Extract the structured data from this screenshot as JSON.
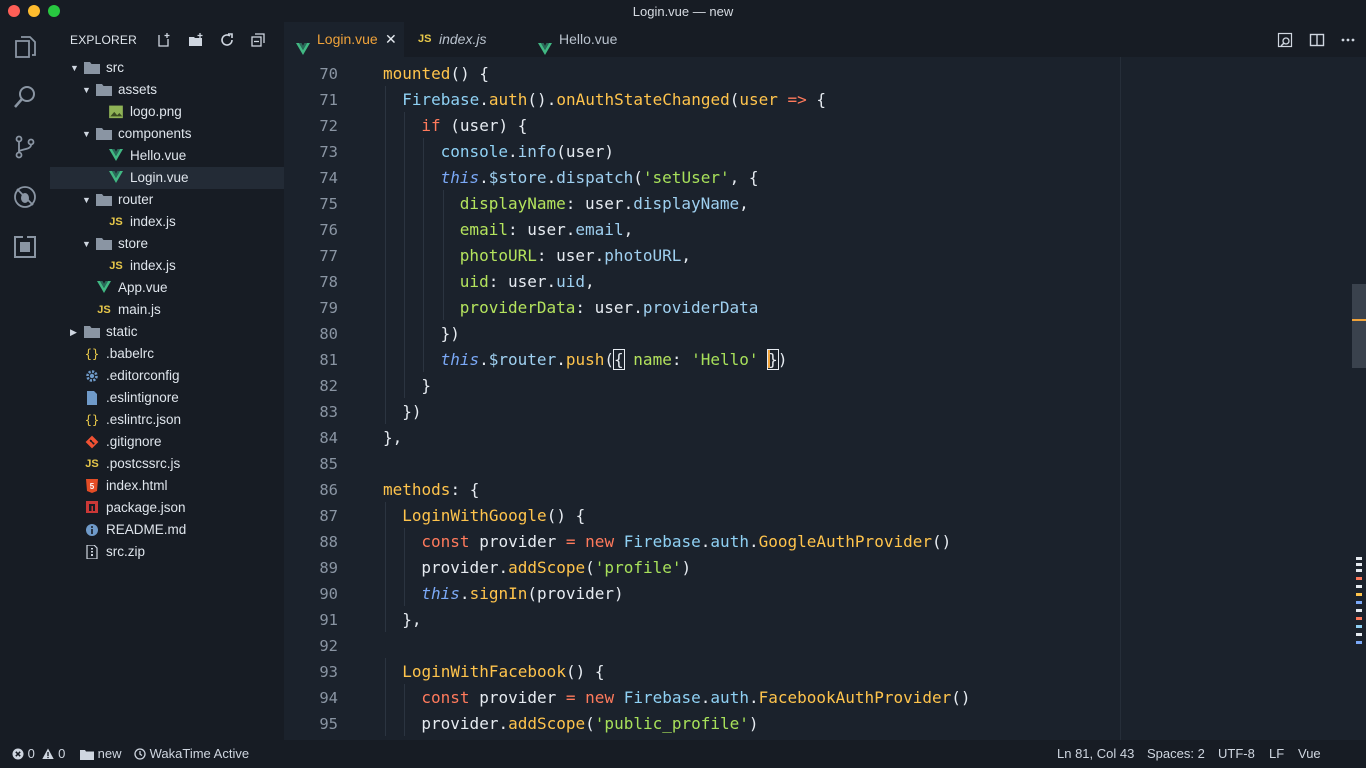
{
  "window": {
    "title": "Login.vue — new"
  },
  "activity_bar": {
    "items": [
      {
        "name": "explorer-icon"
      },
      {
        "name": "search-icon"
      },
      {
        "name": "source-control-icon"
      },
      {
        "name": "debug-icon"
      },
      {
        "name": "extensions-icon"
      }
    ]
  },
  "sidebar": {
    "title": "EXPLORER",
    "tree": [
      {
        "label": "src",
        "type": "folder",
        "depth": 0,
        "expanded": true
      },
      {
        "label": "assets",
        "type": "folder",
        "depth": 1,
        "expanded": true
      },
      {
        "label": "logo.png",
        "type": "image",
        "depth": 2
      },
      {
        "label": "components",
        "type": "folder",
        "depth": 1,
        "expanded": true
      },
      {
        "label": "Hello.vue",
        "type": "vue",
        "depth": 2
      },
      {
        "label": "Login.vue",
        "type": "vue",
        "depth": 2,
        "selected": true
      },
      {
        "label": "router",
        "type": "folder",
        "depth": 1,
        "expanded": true
      },
      {
        "label": "index.js",
        "type": "js",
        "depth": 2
      },
      {
        "label": "store",
        "type": "folder",
        "depth": 1,
        "expanded": true
      },
      {
        "label": "index.js",
        "type": "js",
        "depth": 2
      },
      {
        "label": "App.vue",
        "type": "vue",
        "depth": 1
      },
      {
        "label": "main.js",
        "type": "js",
        "depth": 1
      },
      {
        "label": "static",
        "type": "folder",
        "depth": 0,
        "expanded": false
      },
      {
        "label": ".babelrc",
        "type": "braces",
        "depth": 0
      },
      {
        "label": ".editorconfig",
        "type": "gear",
        "depth": 0
      },
      {
        "label": ".eslintignore",
        "type": "file",
        "depth": 0
      },
      {
        "label": ".eslintrc.json",
        "type": "braces",
        "depth": 0
      },
      {
        "label": ".gitignore",
        "type": "git",
        "depth": 0
      },
      {
        "label": ".postcssrc.js",
        "type": "js",
        "depth": 0
      },
      {
        "label": "index.html",
        "type": "html",
        "depth": 0
      },
      {
        "label": "package.json",
        "type": "npm",
        "depth": 0
      },
      {
        "label": "README.md",
        "type": "info",
        "depth": 0
      },
      {
        "label": "src.zip",
        "type": "zip",
        "depth": 0
      }
    ]
  },
  "tabs": [
    {
      "label": "Login.vue",
      "icon": "vue",
      "active": true,
      "closable": true
    },
    {
      "label": "index.js",
      "icon": "js",
      "italic": true
    },
    {
      "label": "Hello.vue",
      "icon": "vue"
    }
  ],
  "editor": {
    "lines": [
      {
        "n": "70",
        "indent": 0,
        "tokens": [
          [
            "fn",
            "mounted"
          ],
          [
            "pl",
            "() {"
          ]
        ]
      },
      {
        "n": "71",
        "indent": 1,
        "tokens": [
          [
            "cls",
            "Firebase"
          ],
          [
            "pl",
            "."
          ],
          [
            "fn",
            "auth"
          ],
          [
            "pl",
            "()."
          ],
          [
            "fn",
            "onAuthStateChanged"
          ],
          [
            "pl",
            "("
          ],
          [
            "fn",
            "user"
          ],
          [
            "pl",
            " "
          ],
          [
            "op",
            "=>"
          ],
          [
            "pl",
            " {"
          ]
        ]
      },
      {
        "n": "72",
        "indent": 2,
        "tokens": [
          [
            "kw",
            "if"
          ],
          [
            "pl",
            " (user) {"
          ]
        ]
      },
      {
        "n": "73",
        "indent": 3,
        "tokens": [
          [
            "cls",
            "console"
          ],
          [
            "pl",
            "."
          ],
          [
            "prop",
            "info"
          ],
          [
            "pl",
            "(user)"
          ]
        ]
      },
      {
        "n": "74",
        "indent": 3,
        "tokens": [
          [
            "this",
            "this"
          ],
          [
            "pl",
            "."
          ],
          [
            "prop",
            "$store"
          ],
          [
            "pl",
            "."
          ],
          [
            "prop",
            "dispatch"
          ],
          [
            "pl",
            "("
          ],
          [
            "str",
            "'setUser'"
          ],
          [
            "pl",
            ", {"
          ]
        ]
      },
      {
        "n": "75",
        "indent": 4,
        "tokens": [
          [
            "key",
            "displayName"
          ],
          [
            "pl",
            ": user."
          ],
          [
            "prop",
            "displayName"
          ],
          [
            "pl",
            ","
          ]
        ]
      },
      {
        "n": "76",
        "indent": 4,
        "tokens": [
          [
            "key",
            "email"
          ],
          [
            "pl",
            ": user."
          ],
          [
            "prop",
            "email"
          ],
          [
            "pl",
            ","
          ]
        ]
      },
      {
        "n": "77",
        "indent": 4,
        "tokens": [
          [
            "key",
            "photoURL"
          ],
          [
            "pl",
            ": user."
          ],
          [
            "prop",
            "photoURL"
          ],
          [
            "pl",
            ","
          ]
        ]
      },
      {
        "n": "78",
        "indent": 4,
        "tokens": [
          [
            "key",
            "uid"
          ],
          [
            "pl",
            ": user."
          ],
          [
            "prop",
            "uid"
          ],
          [
            "pl",
            ","
          ]
        ]
      },
      {
        "n": "79",
        "indent": 4,
        "tokens": [
          [
            "key",
            "providerData"
          ],
          [
            "pl",
            ": user."
          ],
          [
            "prop",
            "providerData"
          ]
        ]
      },
      {
        "n": "80",
        "indent": 3,
        "tokens": [
          [
            "pl",
            "})"
          ]
        ]
      },
      {
        "n": "81",
        "indent": 3,
        "tokens": [
          [
            "this",
            "this"
          ],
          [
            "pl",
            "."
          ],
          [
            "prop",
            "$router"
          ],
          [
            "pl",
            "."
          ],
          [
            "fn",
            "push"
          ],
          [
            "pl",
            "("
          ],
          [
            "cur",
            "{"
          ],
          [
            "pl",
            " "
          ],
          [
            "key",
            "name"
          ],
          [
            "pl",
            ": "
          ],
          [
            "str",
            "'Hello'"
          ],
          [
            "pl",
            " "
          ],
          [
            "cursor",
            ""
          ],
          [
            "cur",
            "}"
          ],
          [
            "pl",
            ")"
          ]
        ]
      },
      {
        "n": "82",
        "indent": 2,
        "tokens": [
          [
            "pl",
            "}"
          ]
        ]
      },
      {
        "n": "83",
        "indent": 1,
        "tokens": [
          [
            "pl",
            "})"
          ]
        ]
      },
      {
        "n": "84",
        "indent": 0,
        "tokens": [
          [
            "pl",
            "},"
          ]
        ]
      },
      {
        "n": "85",
        "indent": 0,
        "tokens": []
      },
      {
        "n": "86",
        "indent": 0,
        "tokens": [
          [
            "fn",
            "methods"
          ],
          [
            "pl",
            ": {"
          ]
        ]
      },
      {
        "n": "87",
        "indent": 1,
        "tokens": [
          [
            "fn",
            "LoginWithGoogle"
          ],
          [
            "pl",
            "() {"
          ]
        ]
      },
      {
        "n": "88",
        "indent": 2,
        "tokens": [
          [
            "kw",
            "const"
          ],
          [
            "pl",
            " provider "
          ],
          [
            "op",
            "="
          ],
          [
            "pl",
            " "
          ],
          [
            "kw",
            "new"
          ],
          [
            "pl",
            " "
          ],
          [
            "cls",
            "Firebase"
          ],
          [
            "pl",
            "."
          ],
          [
            "cls",
            "auth"
          ],
          [
            "pl",
            "."
          ],
          [
            "fn",
            "GoogleAuthProvider"
          ],
          [
            "pl",
            "()"
          ]
        ]
      },
      {
        "n": "89",
        "indent": 2,
        "tokens": [
          [
            "pl",
            "provider."
          ],
          [
            "fn",
            "addScope"
          ],
          [
            "pl",
            "("
          ],
          [
            "str",
            "'profile'"
          ],
          [
            "pl",
            ")"
          ]
        ]
      },
      {
        "n": "90",
        "indent": 2,
        "tokens": [
          [
            "this",
            "this"
          ],
          [
            "pl",
            "."
          ],
          [
            "fn",
            "signIn"
          ],
          [
            "pl",
            "(provider)"
          ]
        ]
      },
      {
        "n": "91",
        "indent": 1,
        "tokens": [
          [
            "pl",
            "},"
          ]
        ]
      },
      {
        "n": "92",
        "indent": 0,
        "tokens": []
      },
      {
        "n": "93",
        "indent": 1,
        "tokens": [
          [
            "fn",
            "LoginWithFacebook"
          ],
          [
            "pl",
            "() {"
          ]
        ]
      },
      {
        "n": "94",
        "indent": 2,
        "tokens": [
          [
            "kw",
            "const"
          ],
          [
            "pl",
            " provider "
          ],
          [
            "op",
            "="
          ],
          [
            "pl",
            " "
          ],
          [
            "kw",
            "new"
          ],
          [
            "pl",
            " "
          ],
          [
            "cls",
            "Firebase"
          ],
          [
            "pl",
            "."
          ],
          [
            "cls",
            "auth"
          ],
          [
            "pl",
            "."
          ],
          [
            "fn",
            "FacebookAuthProvider"
          ],
          [
            "pl",
            "()"
          ]
        ]
      },
      {
        "n": "95",
        "indent": 2,
        "tokens": [
          [
            "pl",
            "provider."
          ],
          [
            "fn",
            "addScope"
          ],
          [
            "pl",
            "("
          ],
          [
            "str",
            "'public_profile'"
          ],
          [
            "pl",
            ")"
          ]
        ]
      }
    ]
  },
  "statusbar": {
    "errors": "0",
    "warnings": "0",
    "folder": "new",
    "wakatime": "WakaTime Active",
    "position": "Ln 81, Col 43",
    "spaces": "Spaces: 2",
    "encoding": "UTF-8",
    "eol": "LF",
    "language": "Vue"
  },
  "colors": {
    "background": "#1b222c",
    "sidebar": "#171c24",
    "accent": "#f0a33a",
    "vue": "#41b883"
  }
}
